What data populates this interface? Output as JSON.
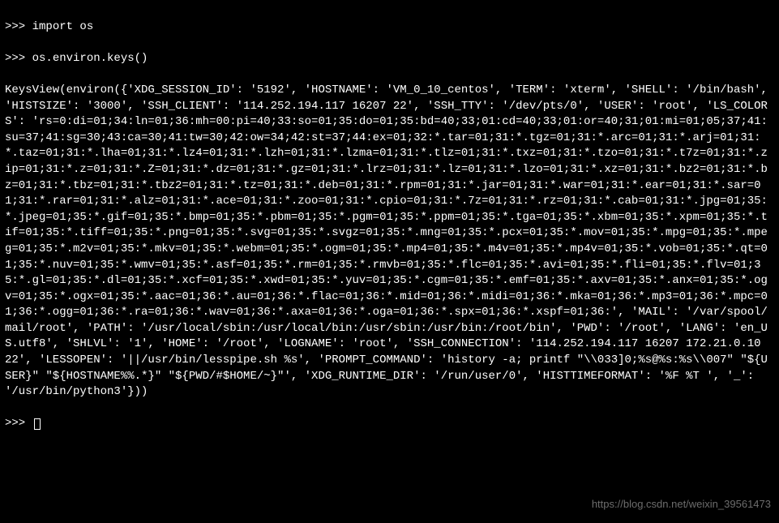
{
  "terminal": {
    "prompt": ">>> ",
    "command1": "import os",
    "command2": "os.environ.keys()",
    "output": "KeysView(environ({'XDG_SESSION_ID': '5192', 'HOSTNAME': 'VM_0_10_centos', 'TERM': 'xterm', 'SHELL': '/bin/bash', 'HISTSIZE': '3000', 'SSH_CLIENT': '114.252.194.117 16207 22', 'SSH_TTY': '/dev/pts/0', 'USER': 'root', 'LS_COLORS': 'rs=0:di=01;34:ln=01;36:mh=00:pi=40;33:so=01;35:do=01;35:bd=40;33;01:cd=40;33;01:or=40;31;01:mi=01;05;37;41:su=37;41:sg=30;43:ca=30;41:tw=30;42:ow=34;42:st=37;44:ex=01;32:*.tar=01;31:*.tgz=01;31:*.arc=01;31:*.arj=01;31:*.taz=01;31:*.lha=01;31:*.lz4=01;31:*.lzh=01;31:*.lzma=01;31:*.tlz=01;31:*.txz=01;31:*.tzo=01;31:*.t7z=01;31:*.zip=01;31:*.z=01;31:*.Z=01;31:*.dz=01;31:*.gz=01;31:*.lrz=01;31:*.lz=01;31:*.lzo=01;31:*.xz=01;31:*.bz2=01;31:*.bz=01;31:*.tbz=01;31:*.tbz2=01;31:*.tz=01;31:*.deb=01;31:*.rpm=01;31:*.jar=01;31:*.war=01;31:*.ear=01;31:*.sar=01;31:*.rar=01;31:*.alz=01;31:*.ace=01;31:*.zoo=01;31:*.cpio=01;31:*.7z=01;31:*.rz=01;31:*.cab=01;31:*.jpg=01;35:*.jpeg=01;35:*.gif=01;35:*.bmp=01;35:*.pbm=01;35:*.pgm=01;35:*.ppm=01;35:*.tga=01;35:*.xbm=01;35:*.xpm=01;35:*.tif=01;35:*.tiff=01;35:*.png=01;35:*.svg=01;35:*.svgz=01;35:*.mng=01;35:*.pcx=01;35:*.mov=01;35:*.mpg=01;35:*.mpeg=01;35:*.m2v=01;35:*.mkv=01;35:*.webm=01;35:*.ogm=01;35:*.mp4=01;35:*.m4v=01;35:*.mp4v=01;35:*.vob=01;35:*.qt=01;35:*.nuv=01;35:*.wmv=01;35:*.asf=01;35:*.rm=01;35:*.rmvb=01;35:*.flc=01;35:*.avi=01;35:*.fli=01;35:*.flv=01;35:*.gl=01;35:*.dl=01;35:*.xcf=01;35:*.xwd=01;35:*.yuv=01;35:*.cgm=01;35:*.emf=01;35:*.axv=01;35:*.anx=01;35:*.ogv=01;35:*.ogx=01;35:*.aac=01;36:*.au=01;36:*.flac=01;36:*.mid=01;36:*.midi=01;36:*.mka=01;36:*.mp3=01;36:*.mpc=01;36:*.ogg=01;36:*.ra=01;36:*.wav=01;36:*.axa=01;36:*.oga=01;36:*.spx=01;36:*.xspf=01;36:', 'MAIL': '/var/spool/mail/root', 'PATH': '/usr/local/sbin:/usr/local/bin:/usr/sbin:/usr/bin:/root/bin', 'PWD': '/root', 'LANG': 'en_US.utf8', 'SHLVL': '1', 'HOME': '/root', 'LOGNAME': 'root', 'SSH_CONNECTION': '114.252.194.117 16207 172.21.0.10 22', 'LESSOPEN': '||/usr/bin/lesspipe.sh %s', 'PROMPT_COMMAND': 'history -a; printf \"\\\\033]0;%s@%s:%s\\\\007\" \"${USER}\" \"${HOSTNAME%%.*}\" \"${PWD/#$HOME/~}\"', 'XDG_RUNTIME_DIR': '/run/user/0', 'HISTTIMEFORMAT': '%F %T ', '_': '/usr/bin/python3'}))"
  },
  "watermark": "https://blog.csdn.net/weixin_39561473"
}
